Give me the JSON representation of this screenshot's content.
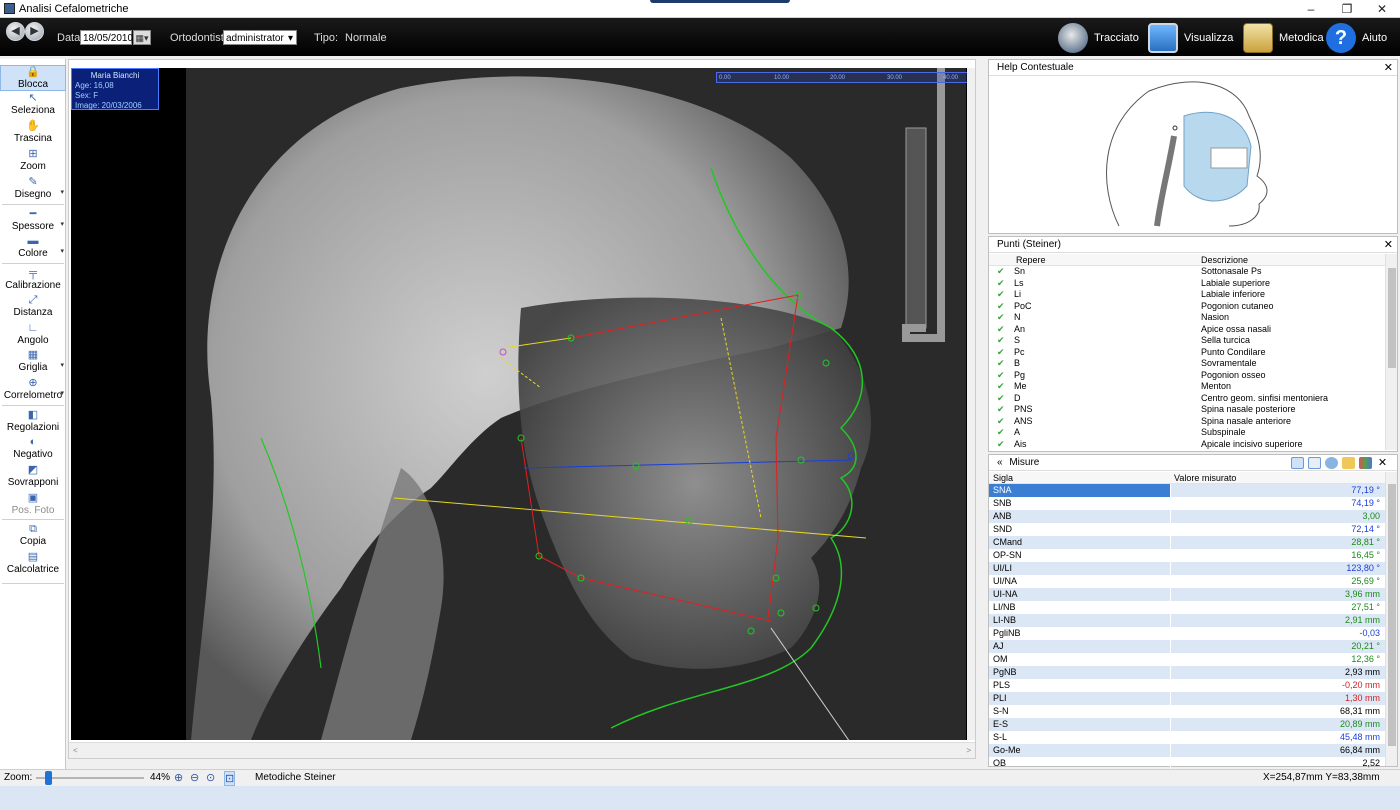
{
  "window": {
    "title": "Analisi Cefalometriche",
    "minimize": "–",
    "restore": "❐",
    "close": "✕"
  },
  "toolbar": {
    "back_glyph": "◀",
    "forward_glyph": "▶",
    "date_label": "Data:",
    "date_value": "18/05/2010",
    "calendar_glyph": "▦▾",
    "ortho_label": "Ortodontista:",
    "ortho_value": "administrator",
    "ortho_chevron": "▾",
    "type_label": "Tipo:",
    "type_value": "Normale",
    "buttons": [
      {
        "label": "Tracciato",
        "icon": "skull-trace-icon",
        "color": "#6b7e96"
      },
      {
        "label": "Visualizza",
        "icon": "monitor-icon",
        "color": "#3a8fd8"
      },
      {
        "label": "Metodica",
        "icon": "clipboard-icon",
        "color": "#d8b347"
      },
      {
        "label": "Aiuto",
        "icon": "help-icon",
        "color": "#1f6fe0"
      }
    ]
  },
  "tools": [
    {
      "label": "Blocca",
      "icon": "🔒",
      "name": "lock-icon"
    },
    {
      "label": "Seleziona",
      "icon": "↖",
      "name": "cursor-icon"
    },
    {
      "label": "Trascina",
      "icon": "✋",
      "name": "hand-icon"
    },
    {
      "label": "Zoom",
      "icon": "⊞",
      "name": "zoom-icon"
    },
    {
      "label": "Disegno",
      "icon": "✎",
      "name": "pencil-icon"
    },
    {
      "label": "Spessore",
      "icon": "━",
      "name": "thickness-icon"
    },
    {
      "label": "Colore",
      "icon": "▬",
      "name": "color-icon"
    },
    {
      "label": "Calibrazione",
      "icon": "╤",
      "name": "calibration-icon"
    },
    {
      "label": "Distanza",
      "icon": "⤢",
      "name": "distance-icon"
    },
    {
      "label": "Angolo",
      "icon": "∟",
      "name": "angle-icon"
    },
    {
      "label": "Griglia",
      "icon": "▦",
      "name": "grid-icon"
    },
    {
      "label": "Correlometro",
      "icon": "⊕",
      "name": "correlometer-icon"
    },
    {
      "label": "Regolazioni",
      "icon": "◧",
      "name": "adjust-icon"
    },
    {
      "label": "Negativo",
      "icon": "◐",
      "name": "negative-icon"
    },
    {
      "label": "Sovrapponi",
      "icon": "◩",
      "name": "overlay-icon"
    },
    {
      "label": "Pos. Foto",
      "icon": "▣",
      "name": "photo-position-icon"
    },
    {
      "label": "Copia",
      "icon": "⧉",
      "name": "copy-icon"
    },
    {
      "label": "Calcolatrice",
      "icon": "▤",
      "name": "calculator-icon"
    }
  ],
  "patient": {
    "name": "Maria Bianchi",
    "age": "Age: 16,08",
    "sex": "Sex: F",
    "image": "Image: 20/03/2006"
  },
  "scale_labels": [
    "0.00",
    "10.00",
    "20.00",
    "30.00",
    "40.00"
  ],
  "help_panel": {
    "title": "Help Contestuale"
  },
  "points_panel": {
    "title": "Punti  (Steiner)",
    "col_repere": "Repere",
    "col_descrizione": "Descrizione",
    "rows": [
      {
        "code": "Sn",
        "desc": "Sottonasale Ps"
      },
      {
        "code": "Ls",
        "desc": "Labiale superiore"
      },
      {
        "code": "Li",
        "desc": "Labiale inferiore"
      },
      {
        "code": "PoC",
        "desc": "Pogonion cutaneo"
      },
      {
        "code": "N",
        "desc": "Nasion"
      },
      {
        "code": "An",
        "desc": "Apice ossa nasali"
      },
      {
        "code": "S",
        "desc": "Sella turcica"
      },
      {
        "code": "Pc",
        "desc": "Punto Condilare"
      },
      {
        "code": "B",
        "desc": "Sovramentale"
      },
      {
        "code": "Pg",
        "desc": "Pogonion osseo"
      },
      {
        "code": "Me",
        "desc": "Menton"
      },
      {
        "code": "D",
        "desc": "Centro geom. sinfisi mentoniera"
      },
      {
        "code": "PNS",
        "desc": "Spina nasale posteriore"
      },
      {
        "code": "ANS",
        "desc": "Spina nasale anteriore"
      },
      {
        "code": "A",
        "desc": "Subspinale"
      },
      {
        "code": "Ais",
        "desc": "Apicale incisivo superiore"
      }
    ]
  },
  "measures_panel": {
    "title": "Misure",
    "collapse_glyph": "«",
    "col_sigla": "Sigla",
    "col_valore": "Valore misurato",
    "rows": [
      {
        "code": "SNA",
        "value": "77,19 °",
        "color": "#1a3fd6"
      },
      {
        "code": "SNB",
        "value": "74,19 °",
        "color": "#1a3fd6"
      },
      {
        "code": "ANB",
        "value": "3,00",
        "color": "#1a8a1a"
      },
      {
        "code": "SND",
        "value": "72,14 °",
        "color": "#1a3fd6"
      },
      {
        "code": "CMand",
        "value": "28,81 °",
        "color": "#1a8a1a"
      },
      {
        "code": "OP-SN",
        "value": "16,45 °",
        "color": "#1a8a1a"
      },
      {
        "code": "UI/LI",
        "value": "123,80 °",
        "color": "#1a3fd6"
      },
      {
        "code": "UI/NA",
        "value": "25,69 °",
        "color": "#1a8a1a"
      },
      {
        "code": "UI-NA",
        "value": "3,96 mm",
        "color": "#1a8a1a"
      },
      {
        "code": "LI/NB",
        "value": "27,51 °",
        "color": "#1a8a1a"
      },
      {
        "code": "LI-NB",
        "value": "2,91 mm",
        "color": "#1a8a1a"
      },
      {
        "code": "PgliNB",
        "value": "-0,03",
        "color": "#1a3fd6"
      },
      {
        "code": "AJ",
        "value": "20,21 °",
        "color": "#1a8a1a"
      },
      {
        "code": "OM",
        "value": "12,36 °",
        "color": "#1a8a1a"
      },
      {
        "code": "PgNB",
        "value": "2,93 mm",
        "color": "#000000"
      },
      {
        "code": "PLS",
        "value": "-0,20 mm",
        "color": "#d62020"
      },
      {
        "code": "PLI",
        "value": "1,30 mm",
        "color": "#d62020"
      },
      {
        "code": "S-N",
        "value": "68,31 mm",
        "color": "#000000"
      },
      {
        "code": "E-S",
        "value": "20,89 mm",
        "color": "#1a8a1a"
      },
      {
        "code": "S-L",
        "value": "45,48 mm",
        "color": "#1a3fd6"
      },
      {
        "code": "Go-Me",
        "value": "66,84 mm",
        "color": "#000000"
      },
      {
        "code": "OB",
        "value": "2,52",
        "color": "#000000"
      }
    ]
  },
  "statusbar": {
    "zoom_label": "Zoom:",
    "zoom_value": "44%",
    "zoom_fraction": 0.44,
    "method": "Metodiche  Steiner",
    "coords": "X=254,87mm Y=83,38mm"
  },
  "colors": {
    "toolbar_bg": "#000000",
    "selection": "#3b7fd4",
    "overlay_blue": "#1a3fd6",
    "tracing_red": "#e02020",
    "tracing_yellow": "#e8d820",
    "tracing_green": "#22c822"
  }
}
